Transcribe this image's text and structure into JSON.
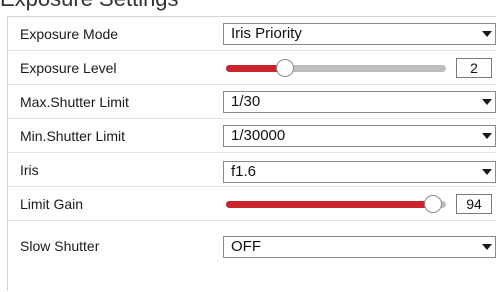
{
  "header": {
    "title": "Exposure Settings"
  },
  "settings": {
    "exposure_mode": {
      "label": "Exposure Mode",
      "value": "Iris Priority"
    },
    "exposure_level": {
      "label": "Exposure Level",
      "value": "2",
      "fraction": 0.27
    },
    "max_shutter_limit": {
      "label": "Max.Shutter Limit",
      "value": "1/30"
    },
    "min_shutter_limit": {
      "label": "Min.Shutter Limit",
      "value": "1/30000"
    },
    "iris": {
      "label": "Iris",
      "value": "f1.6"
    },
    "limit_gain": {
      "label": "Limit Gain",
      "value": "94",
      "fraction": 0.94
    },
    "slow_shutter": {
      "label": "Slow Shutter",
      "value": "OFF"
    }
  },
  "icons": {
    "dropdown": "chevron-down-icon",
    "slider_thumb": "slider-thumb"
  },
  "colors": {
    "slider_fill": "#c9252b",
    "slider_track": "#bdbdbd"
  }
}
